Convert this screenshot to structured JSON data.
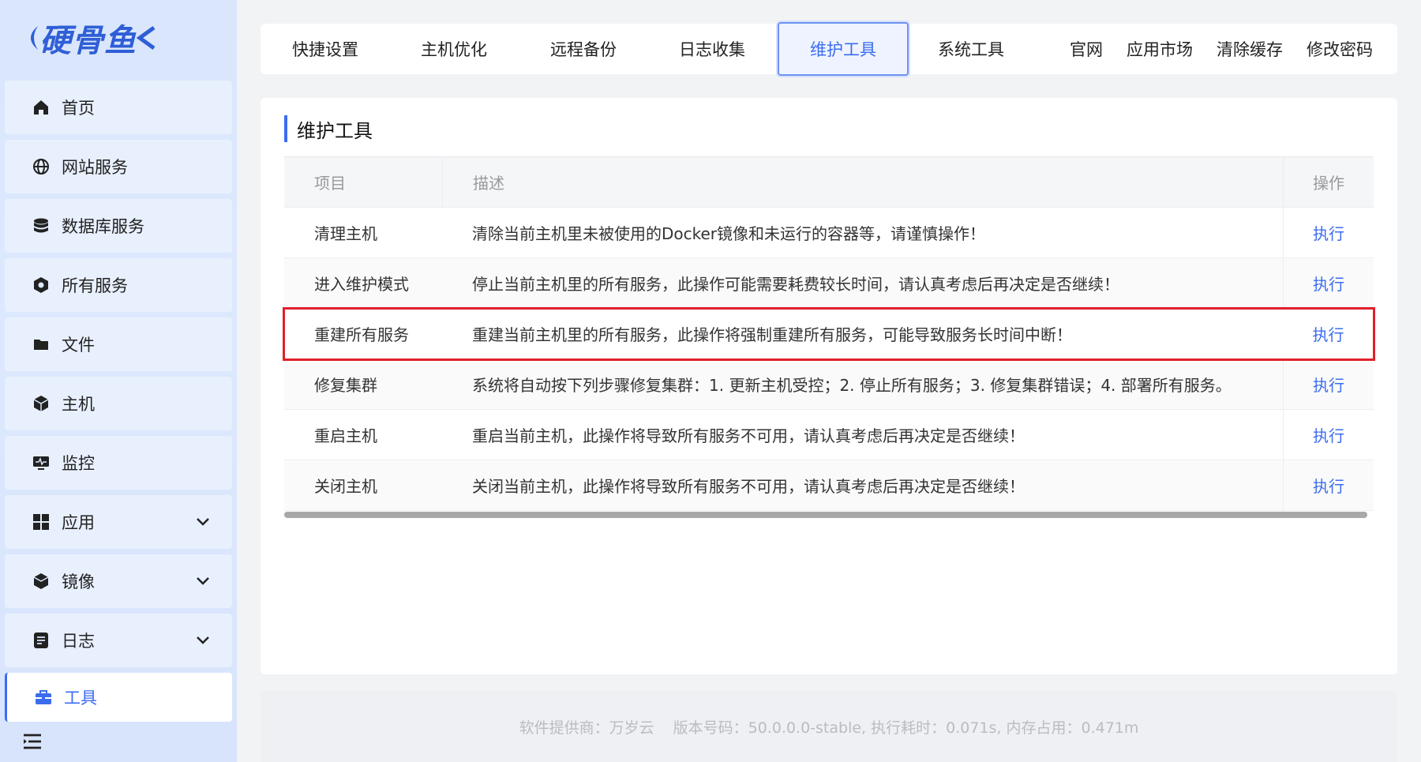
{
  "brand": {
    "logo_text": "硬骨鱼"
  },
  "sidebar": {
    "items": [
      {
        "label": "首页",
        "icon": "home-icon"
      },
      {
        "label": "网站服务",
        "icon": "globe-icon"
      },
      {
        "label": "数据库服务",
        "icon": "database-icon"
      },
      {
        "label": "所有服务",
        "icon": "services-icon"
      },
      {
        "label": "文件",
        "icon": "folder-icon"
      },
      {
        "label": "主机",
        "icon": "cube-icon"
      },
      {
        "label": "监控",
        "icon": "monitor-icon"
      },
      {
        "label": "应用",
        "icon": "apps-grid-icon",
        "expandable": true
      },
      {
        "label": "镜像",
        "icon": "box-icon",
        "expandable": true
      },
      {
        "label": "日志",
        "icon": "log-icon",
        "expandable": true
      },
      {
        "label": "工具",
        "icon": "toolbox-icon",
        "active": true
      }
    ],
    "collapse_icon": "menu-collapse-icon"
  },
  "topnav": {
    "tabs": [
      "快捷设置",
      "主机优化",
      "远程备份",
      "日志收集",
      "维护工具",
      "系统工具"
    ],
    "active_tab": "维护工具",
    "links": [
      "官网",
      "应用市场",
      "清除缓存",
      "修改密码"
    ]
  },
  "main": {
    "title": "维护工具",
    "table": {
      "headers": {
        "name": "项目",
        "desc": "描述",
        "op": "操作"
      },
      "rows": [
        {
          "name": "清理主机",
          "desc": "清除当前主机里未被使用的Docker镜像和未运行的容器等，请谨慎操作！",
          "op": "执行"
        },
        {
          "name": "进入维护模式",
          "desc": "停止当前主机里的所有服务，此操作可能需要耗费较长时间，请认真考虑后再决定是否继续！",
          "op": "执行"
        },
        {
          "name": "重建所有服务",
          "desc": "重建当前主机里的所有服务，此操作将强制重建所有服务，可能导致服务长时间中断！",
          "op": "执行",
          "highlighted": true
        },
        {
          "name": "修复集群",
          "desc": "系统将自动按下列步骤修复集群：1. 更新主机受控；2. 停止所有服务；3. 修复集群错误；4. 部署所有服务。",
          "op": "执行"
        },
        {
          "name": "重启主机",
          "desc": "重启当前主机，此操作将导致所有服务不可用，请认真考虑后再决定是否继续！",
          "op": "执行"
        },
        {
          "name": "关闭主机",
          "desc": "关闭当前主机，此操作将导致所有服务不可用，请认真考虑后再决定是否继续！",
          "op": "执行"
        }
      ]
    }
  },
  "footer": {
    "provider": "软件提供商：万岁云",
    "version_info": "版本号码：50.0.0.0-stable, 执行耗时：0.071s, 内存占用：0.471m"
  },
  "colors": {
    "accent": "#3b6cf0",
    "highlight": "#e0202b",
    "sidebar_bg": "#dce8fd"
  }
}
